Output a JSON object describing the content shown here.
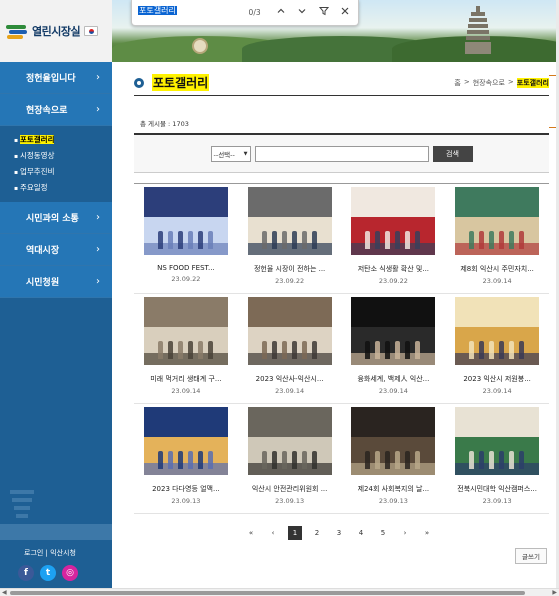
{
  "find_bar": {
    "query": "포토갤러리",
    "count": "0/3",
    "prev_icon": "chevron-up-icon",
    "next_icon": "chevron-down-icon",
    "filter_icon": "filter-icon",
    "close_icon": "close-icon"
  },
  "brand": {
    "title": "열린시장실",
    "logo_colors": [
      "#2e8b3a",
      "#1e5fb0",
      "#e6a31b"
    ]
  },
  "sidebar": {
    "menu_top": [
      {
        "label": "정헌율입니다"
      },
      {
        "label": "현장속으로"
      }
    ],
    "submenu": [
      {
        "label": "포토갤러리",
        "active": true
      },
      {
        "label": "시정동영상"
      },
      {
        "label": "업무추진비"
      },
      {
        "label": "주요일정"
      }
    ],
    "menu_bottom": [
      {
        "label": "시민과의 소통"
      },
      {
        "label": "역대시장"
      },
      {
        "label": "시민청원"
      }
    ],
    "footer_links": "로그인 | 익산시청",
    "social": [
      {
        "name": "facebook-icon",
        "glyph": "f",
        "color": "#3b5998"
      },
      {
        "name": "twitter-icon",
        "glyph": "t",
        "color": "#1da1f2"
      },
      {
        "name": "instagram-icon",
        "glyph": "◎",
        "color": "#d6249f"
      }
    ]
  },
  "page": {
    "title": "포토갤러리",
    "breadcrumb": [
      "홈",
      ">",
      "현장속으로",
      ">",
      "포토갤러리"
    ],
    "post_count": "총 게시물 : 1703"
  },
  "search": {
    "select_value": "--선택--",
    "input_value": "",
    "button_label": "검색"
  },
  "gallery": [
    [
      {
        "title": "NS FOOD FEST...",
        "date": "23.09.22",
        "tone": [
          "#2c3e7a",
          "#c8d6f0",
          "#6a7fb8"
        ]
      },
      {
        "title": "정헌율 시장이 전하는 ...",
        "date": "23.09.22",
        "tone": [
          "#6b6b6b",
          "#e8e0d0",
          "#2e3d56"
        ]
      },
      {
        "title": "저탄소 식생활 확산 및...",
        "date": "23.09.22",
        "tone": [
          "#f0e8e0",
          "#b8262e",
          "#3a3f5a"
        ]
      },
      {
        "title": "제8회 익산시 주민자치...",
        "date": "23.09.14",
        "tone": [
          "#3f7a5e",
          "#d8c6a0",
          "#b03a3a"
        ]
      }
    ],
    [
      {
        "title": "미래 먹거리 생태계 구...",
        "date": "23.09.14",
        "tone": [
          "#8a7b68",
          "#d9cfbd",
          "#4a4338"
        ]
      },
      {
        "title": "2023 익산사-익산시...",
        "date": "23.09.14",
        "tone": [
          "#7d6a56",
          "#ddd3c3",
          "#3e3a36"
        ]
      },
      {
        "title": "융화세계, 백제人 익산...",
        "date": "23.09.14",
        "tone": [
          "#111111",
          "#2a2a2a",
          "#c9b49a"
        ]
      },
      {
        "title": "2023 익산시 저원봉...",
        "date": "23.09.14",
        "tone": [
          "#f1e2b8",
          "#d9a64a",
          "#3a3a55"
        ]
      }
    ],
    [
      {
        "title": "2023 다다영등 얼맥...",
        "date": "23.09.13",
        "tone": [
          "#1f3a78",
          "#e4b25a",
          "#5a6fb0"
        ]
      },
      {
        "title": "익산시 안전관리위원회 ...",
        "date": "23.09.13",
        "tone": [
          "#6a665d",
          "#cfc8b8",
          "#33312d"
        ]
      },
      {
        "title": "제24회 사회복지의 날...",
        "date": "23.09.13",
        "tone": [
          "#2a2420",
          "#5a4a3a",
          "#b8a88a"
        ]
      },
      {
        "title": "전북시민대학 익산캠퍼스...",
        "date": "23.09.13",
        "tone": [
          "#e8e2d4",
          "#3a7a4a",
          "#2c3e6a"
        ]
      }
    ]
  ],
  "pagination": {
    "first": "«",
    "prev": "‹",
    "pages": [
      "1",
      "2",
      "3",
      "4",
      "5"
    ],
    "current": "1",
    "next": "›",
    "last": "»"
  },
  "write_button": "글쓰기"
}
